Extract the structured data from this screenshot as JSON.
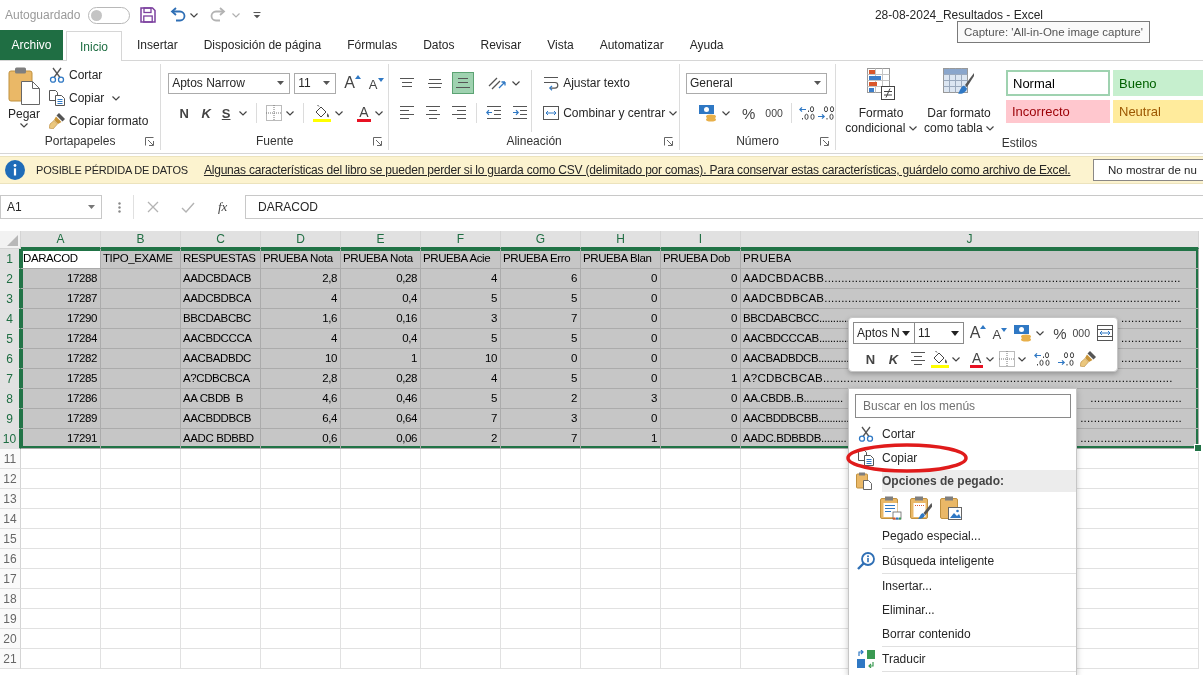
{
  "title_bar": {
    "autosave": {
      "label": "Autoguardado",
      "on": false
    },
    "quick_access": [
      {
        "kind": "save",
        "disabled": false
      },
      {
        "kind": "undo",
        "disabled": false
      },
      {
        "kind": "redo",
        "disabled": true
      },
      {
        "kind": "customize",
        "disabled": false
      }
    ],
    "title": "28-08-2024_Resultados - Excel",
    "tooltip": "Capture: 'All-in-One image capture'"
  },
  "tabs": [
    {
      "label": "Archivo",
      "kind": "file",
      "selected": false
    },
    {
      "label": "Inicio",
      "kind": "tab",
      "selected": true
    },
    {
      "label": "Insertar",
      "kind": "tab",
      "selected": false
    },
    {
      "label": "Disposición de página",
      "kind": "tab",
      "selected": false
    },
    {
      "label": "Fórmulas",
      "kind": "tab",
      "selected": false
    },
    {
      "label": "Datos",
      "kind": "tab",
      "selected": false
    },
    {
      "label": "Revisar",
      "kind": "tab",
      "selected": false
    },
    {
      "label": "Vista",
      "kind": "tab",
      "selected": false
    },
    {
      "label": "Automatizar",
      "kind": "tab",
      "selected": false
    },
    {
      "label": "Ayuda",
      "kind": "tab",
      "selected": false
    }
  ],
  "ribbon": {
    "clipboard": {
      "label": "Portapapeles",
      "paste": "Pegar",
      "cut": "Cortar",
      "copy": "Copiar",
      "format_painter": "Copiar formato"
    },
    "font": {
      "label": "Fuente",
      "font_name": "Aptos Narrow",
      "font_size": "11",
      "grow": "A",
      "shrink": "A",
      "bold": "N",
      "italic": "K",
      "underline": "S",
      "font_color": "A"
    },
    "alignment": {
      "label": "Alineación",
      "vertical": [
        {
          "kind": "top",
          "selected": false
        },
        {
          "kind": "middle",
          "selected": false
        },
        {
          "kind": "bottom",
          "selected": true
        }
      ],
      "wrap_text": "Ajustar texto",
      "merge_center": "Combinar y centrar"
    },
    "number": {
      "label": "Número",
      "format": "General",
      "percent": "%",
      "thousands": "000"
    },
    "styles": {
      "label": "Estilos",
      "conditional_format": "Formato condicional",
      "format_as_table": "Dar formato como tabla",
      "gallery": [
        {
          "name": "Normal",
          "kind": "normal",
          "selected": true
        },
        {
          "name": "Bueno",
          "kind": "good",
          "selected": false
        },
        {
          "name": "Incorrecto",
          "kind": "bad",
          "selected": false
        },
        {
          "name": "Neutral",
          "kind": "neutral",
          "selected": false
        }
      ]
    }
  },
  "info_bar": {
    "title": "POSIBLE PÉRDIDA DE DATOS",
    "message": "Algunas características del libro se pueden perder si lo guarda como CSV (delimitado por comas). Para conservar estas características, guárdelo como archivo de Excel.",
    "button": "No mostrar de nu"
  },
  "formula_bar": {
    "name_box": "A1",
    "actions": [
      {
        "kind": "cancel",
        "disabled": true
      },
      {
        "kind": "enter",
        "disabled": true
      },
      {
        "kind": "function",
        "label": "fx",
        "disabled": false
      }
    ],
    "formula": "DARACOD"
  },
  "sheet": {
    "columns": [
      {
        "letter": "A",
        "selected": true,
        "kind": "number"
      },
      {
        "letter": "B",
        "selected": true,
        "kind": "text"
      },
      {
        "letter": "C",
        "selected": true,
        "kind": "text"
      },
      {
        "letter": "D",
        "selected": true,
        "kind": "number"
      },
      {
        "letter": "E",
        "selected": true,
        "kind": "number"
      },
      {
        "letter": "F",
        "selected": true,
        "kind": "number"
      },
      {
        "letter": "G",
        "selected": true,
        "kind": "number"
      },
      {
        "letter": "H",
        "selected": true,
        "kind": "number"
      },
      {
        "letter": "I",
        "selected": true,
        "kind": "number"
      },
      {
        "letter": "J",
        "selected": true,
        "kind": "text"
      }
    ],
    "rows": [
      {
        "number": "1",
        "selected": true,
        "kind": "header",
        "cells": [
          "DARACOD",
          "TIPO_EXAME",
          "RESPUESTAS",
          "PRUEBA Nota",
          "PRUEBA Nota",
          "PRUEBA Acie",
          "PRUEBA Erro",
          "PRUEBA Blan",
          "PRUEBA Dob",
          "PRUEBA"
        ]
      },
      {
        "number": "2",
        "selected": true,
        "kind": "data",
        "cells": [
          "17288",
          null,
          "AADCBDACB",
          "2,8",
          "0,28",
          "4",
          "6",
          "0",
          "0",
          "AADCBDACBB........................................................................................................."
        ]
      },
      {
        "number": "3",
        "selected": true,
        "kind": "data",
        "cells": [
          "17287",
          null,
          "AADCBDBCA",
          "4",
          "0,4",
          "5",
          "5",
          "0",
          "0",
          "AADCBDBCAB........................................................................................................."
        ]
      },
      {
        "number": "4",
        "selected": true,
        "kind": "data",
        "cells": [
          "17290",
          null,
          "BBCDABCBC",
          "1,6",
          "0,16",
          "3",
          "7",
          "0",
          "0",
          "BBCDABCBCC..........."
        ],
        "j_right_part": ".................."
      },
      {
        "number": "5",
        "selected": true,
        "kind": "data",
        "cells": [
          "17284",
          null,
          "AACBDCCCA",
          "4",
          "0,4",
          "5",
          "5",
          "0",
          "0",
          "AACBDCCCAB..........."
        ],
        "j_right_part": ".................."
      },
      {
        "number": "6",
        "selected": true,
        "kind": "data",
        "cells": [
          "17282",
          null,
          "AACBADBDC",
          "10",
          "1",
          "10",
          "0",
          "0",
          "0",
          "AACBADBDCB..........."
        ],
        "j_right_part": ".................."
      },
      {
        "number": "7",
        "selected": true,
        "kind": "data",
        "cells": [
          "17285",
          null,
          "A?CDBCBCA",
          "2,8",
          "0,28",
          "4",
          "5",
          "0",
          "1",
          "A?CDBCBCAB......................................................................................................."
        ]
      },
      {
        "number": "8",
        "selected": true,
        "kind": "data",
        "cells": [
          "17286",
          null,
          "AA CBDB  B",
          "4,6",
          "0,46",
          "5",
          "2",
          "3",
          "0",
          "AA.CBDB..B.............."
        ],
        "j_right_part": "..........................."
      },
      {
        "number": "9",
        "selected": true,
        "kind": "data",
        "cells": [
          "17289",
          null,
          "AACBDDBCB",
          "6,4",
          "0,64",
          "7",
          "3",
          "0",
          "0",
          "AACBDDBCBB..........."
        ],
        "j_right_part": ".............................."
      },
      {
        "number": "10",
        "selected": true,
        "kind": "data",
        "cells": [
          "17291",
          null,
          "AADC BDBBD",
          "0,6",
          "0,06",
          "2",
          "7",
          "1",
          "0",
          "AADC.BDBBDB........."
        ],
        "j_right_part": ".............................."
      },
      {
        "number": "11",
        "selected": false,
        "kind": "empty"
      },
      {
        "number": "12",
        "selected": false,
        "kind": "empty"
      },
      {
        "number": "13",
        "selected": false,
        "kind": "empty"
      },
      {
        "number": "14",
        "selected": false,
        "kind": "empty"
      },
      {
        "number": "15",
        "selected": false,
        "kind": "empty"
      },
      {
        "number": "16",
        "selected": false,
        "kind": "empty"
      },
      {
        "number": "17",
        "selected": false,
        "kind": "empty"
      },
      {
        "number": "18",
        "selected": false,
        "kind": "empty"
      },
      {
        "number": "19",
        "selected": false,
        "kind": "empty"
      },
      {
        "number": "20",
        "selected": false,
        "kind": "empty"
      },
      {
        "number": "21",
        "selected": false,
        "kind": "empty"
      }
    ]
  },
  "mini_toolbar": {
    "font_name": "Aptos N",
    "font_size": "11",
    "grow": "A",
    "shrink": "A",
    "percent": "%",
    "thousands": "000",
    "bold": "N",
    "italic": "K",
    "font_color": "A"
  },
  "context_menu": {
    "search_placeholder": "Buscar en los menús",
    "sections": [
      {
        "items": [
          {
            "kind": "cut",
            "label": "Cortar",
            "highlighted": false
          },
          {
            "kind": "copy",
            "label": "Copiar",
            "highlighted": true
          },
          {
            "kind": "paste_header",
            "label": "Opciones de pegado:",
            "highlighted": false
          },
          {
            "kind": "paste_buttons",
            "highlighted": false
          },
          {
            "kind": "command",
            "label": "Pegado especial...",
            "highlighted": false
          }
        ]
      },
      {
        "items": [
          {
            "kind": "smart_lookup",
            "label": "Búsqueda inteligente",
            "highlighted": false
          }
        ]
      },
      {
        "items": [
          {
            "kind": "command",
            "label": "Insertar...",
            "highlighted": false
          },
          {
            "kind": "command",
            "label": "Eliminar...",
            "highlighted": false
          },
          {
            "kind": "command",
            "label": "Borrar contenido",
            "highlighted": false
          }
        ]
      },
      {
        "items": [
          {
            "kind": "translate",
            "label": "Traducir",
            "highlighted": false
          }
        ]
      }
    ]
  }
}
